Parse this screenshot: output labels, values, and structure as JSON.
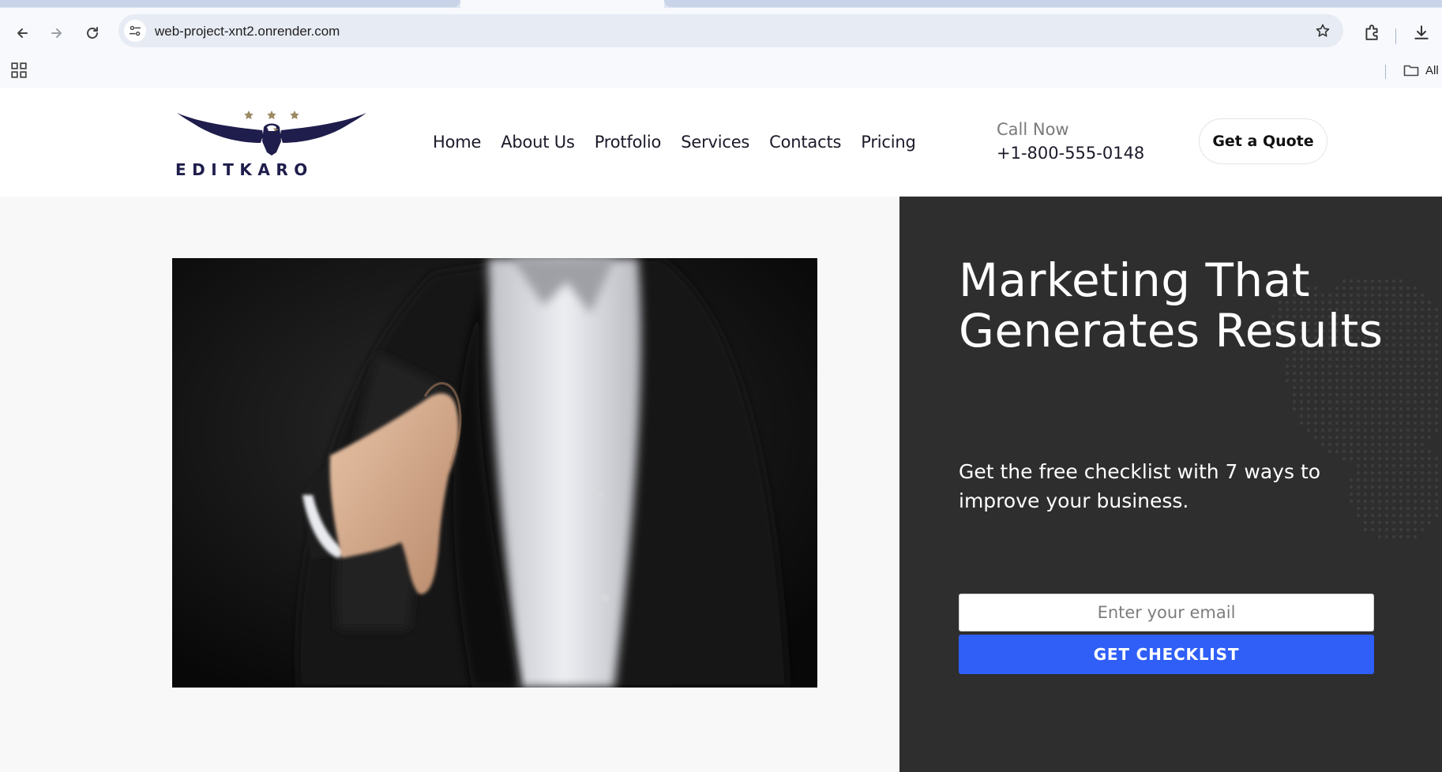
{
  "browser": {
    "url": "web-project-xnt2.onrender.com",
    "bookmarks_all_label": "All"
  },
  "site": {
    "brand": "EDITKARO",
    "nav": [
      {
        "label": "Home"
      },
      {
        "label": "About Us"
      },
      {
        "label": "Protfolio"
      },
      {
        "label": "Services"
      },
      {
        "label": "Contacts"
      },
      {
        "label": "Pricing"
      }
    ],
    "call_label": "Call Now",
    "phone": "+1-800-555-0148",
    "quote_button": "Get a Quote"
  },
  "hero": {
    "title": "Marketing That Generates Results",
    "subtitle": "Get the free checklist with 7 ways to improve your business.",
    "email_placeholder": "Enter your email",
    "cta_label": "GET CHECKLIST"
  },
  "colors": {
    "brand_navy": "#1e1d4c",
    "accent_blue": "#2f5ff7",
    "hero_dark": "#2e2e2e",
    "star_gold": "#9c8a63"
  },
  "icons": [
    "back-icon",
    "forward-icon",
    "reload-icon",
    "site-settings-icon",
    "bookmark-star-icon",
    "extensions-icon",
    "download-icon",
    "apps-grid-icon",
    "folder-icon"
  ]
}
